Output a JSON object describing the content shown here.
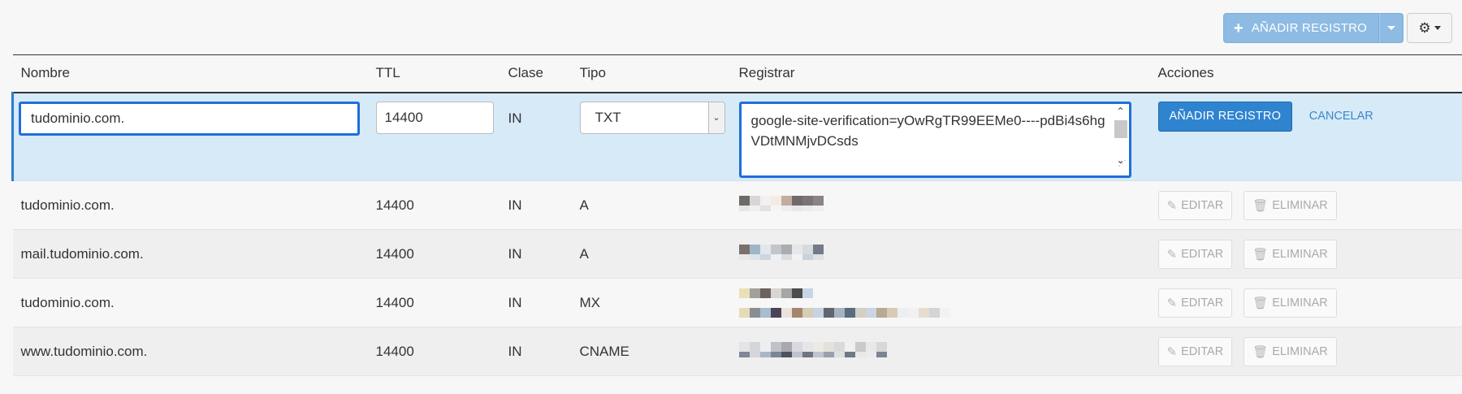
{
  "toolbar": {
    "add_label": "AÑADIR REGISTRO",
    "add_icon": "plus-icon",
    "split_icon": "caret-down-icon",
    "settings_icon": "gear-icon"
  },
  "columns": {
    "name": "Nombre",
    "ttl": "TTL",
    "class": "Clase",
    "type": "Tipo",
    "record": "Registrar",
    "actions": "Acciones"
  },
  "edit_row": {
    "name_value": "tudominio.com.",
    "ttl_value": "14400",
    "class_value": "IN",
    "type_value": "TXT",
    "record_value": "google-site-verification=yOwRgTR99EEMe0----pdBi4s6hgVDtMNMjvDCsds",
    "add_button": "AÑADIR REGISTRO",
    "cancel_link": "CANCELAR"
  },
  "rows": [
    {
      "name": "tudominio.com.",
      "ttl": "14400",
      "class": "IN",
      "type": "A"
    },
    {
      "name": "mail.tudominio.com.",
      "ttl": "14400",
      "class": "IN",
      "type": "A"
    },
    {
      "name": "tudominio.com.",
      "ttl": "14400",
      "class": "IN",
      "type": "MX"
    },
    {
      "name": "www.tudominio.com.",
      "ttl": "14400",
      "class": "IN",
      "type": "CNAME"
    }
  ],
  "row_actions": {
    "edit_label": "EDITAR",
    "edit_icon": "pencil-icon",
    "delete_label": "ELIMINAR",
    "delete_icon": "trash-icon"
  },
  "colors": {
    "accent": "#3a87c8",
    "edit_row_bg": "#d7eaf8",
    "focus_border": "#1f6fd9",
    "primary_button": "#2f84d0"
  }
}
